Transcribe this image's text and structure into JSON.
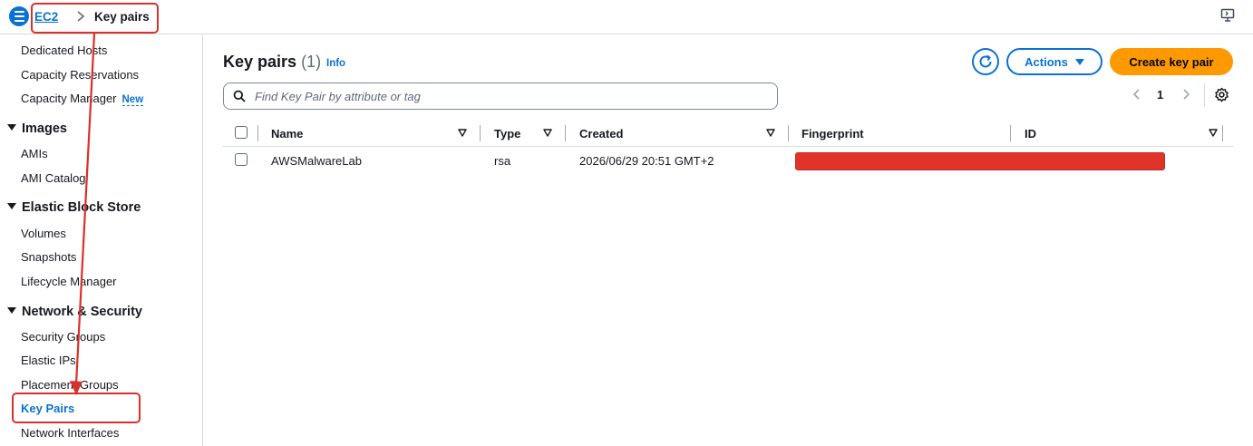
{
  "breadcrumb": {
    "root": "EC2",
    "current": "Key pairs"
  },
  "sidebar": {
    "items": [
      {
        "kind": "item",
        "label": "Dedicated Hosts"
      },
      {
        "kind": "item",
        "label": "Capacity Reservations"
      },
      {
        "kind": "item",
        "label": "Capacity Manager",
        "badge": "New"
      },
      {
        "kind": "section",
        "label": "Images"
      },
      {
        "kind": "item",
        "label": "AMIs"
      },
      {
        "kind": "item",
        "label": "AMI Catalog"
      },
      {
        "kind": "section",
        "label": "Elastic Block Store"
      },
      {
        "kind": "item",
        "label": "Volumes"
      },
      {
        "kind": "item",
        "label": "Snapshots"
      },
      {
        "kind": "item",
        "label": "Lifecycle Manager"
      },
      {
        "kind": "section",
        "label": "Network & Security"
      },
      {
        "kind": "item",
        "label": "Security Groups"
      },
      {
        "kind": "item",
        "label": "Elastic IPs"
      },
      {
        "kind": "item",
        "label": "Placement Groups"
      },
      {
        "kind": "item",
        "label": "Key Pairs",
        "active": true
      },
      {
        "kind": "item",
        "label": "Network Interfaces"
      }
    ]
  },
  "header": {
    "title": "Key pairs",
    "count": "(1)",
    "info": "Info",
    "actions_label": "Actions",
    "create_label": "Create key pair"
  },
  "search": {
    "placeholder": "Find Key Pair by attribute or tag",
    "value": ""
  },
  "pagination": {
    "current_page": "1"
  },
  "table": {
    "columns": [
      "Name",
      "Type",
      "Created",
      "Fingerprint",
      "ID"
    ],
    "rows": [
      {
        "name": "AWSMalwareLab",
        "type": "rsa",
        "created": "2026/06/29 20:51 GMT+2",
        "fingerprint": "",
        "id": ""
      }
    ]
  },
  "colors": {
    "accent": "#0972d3",
    "primary_button": "#ff9900",
    "annotation": "#d9302b",
    "redaction": "#e0342a"
  },
  "icons": [
    "menu-icon",
    "chevron-right-icon",
    "screen-icon",
    "refresh-icon",
    "caret-down-icon",
    "search-icon",
    "chevron-left-icon",
    "settings-icon",
    "sort-icon"
  ]
}
